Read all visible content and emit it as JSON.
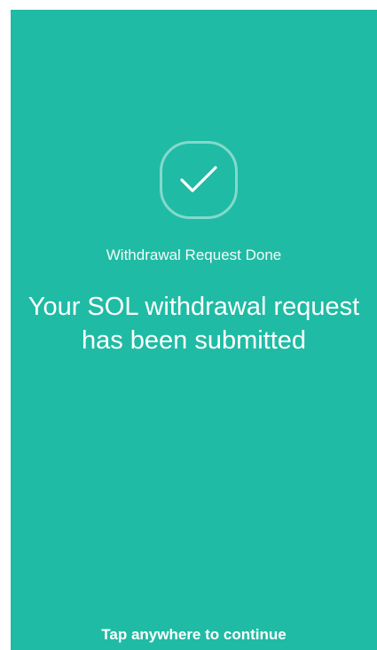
{
  "screen": {
    "background_color": "#20bba4",
    "status_icon": "checkmark-icon",
    "subtitle": "Withdrawal Request Done",
    "headline": "Your SOL withdrawal request has been submitted",
    "footer_hint": "Tap anywhere to continue"
  }
}
